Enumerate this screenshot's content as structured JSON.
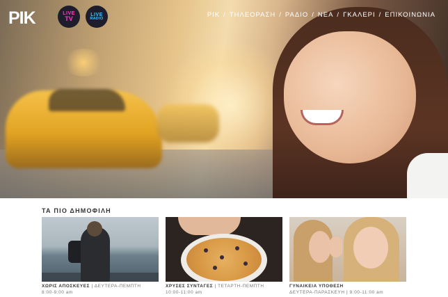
{
  "brand": {
    "logo_text": "ΡΙΚ"
  },
  "live": {
    "tv": {
      "line1": "LIVE",
      "line2": "TV"
    },
    "radio": {
      "line1": "LIVE",
      "line2": "RADIO"
    }
  },
  "nav": {
    "items": [
      {
        "label": "ΡΙΚ"
      },
      {
        "label": "ΤΗΛΕΟΡΑΣΗ"
      },
      {
        "label": "ΡΑΔΙΟ"
      },
      {
        "label": "ΝΕΑ"
      },
      {
        "label": "ΓΚΑΛΕΡΙ"
      },
      {
        "label": "ΕΠΙΚΟΙΝΩΝΙΑ"
      }
    ],
    "separator": "/"
  },
  "popular": {
    "title": "ΤΑ ΠΙΟ ΔΗΜΟΦΙΛΗ",
    "cards": [
      {
        "title": "ΧΩΡΙΣ ΑΠΟΣΚΕΥΕΣ",
        "days": "ΔΕΥΤΕΡΑ-ΠΕΜΠΤΗ",
        "time": "8:00-9:00 am"
      },
      {
        "title": "ΧΡΥΣΕΣ ΣΥΝΤΑΓΕΣ",
        "days": "ΤΕΤΑΡΤΗ-ΠΕΜΠΤΗ",
        "time": "10:00-11:00 am"
      },
      {
        "title": "ΓΥΝΑΙΚΕΙΑ ΥΠΟΘΕΣΗ",
        "days": "ΔΕΥΤΕΡΑ-ΠΑΡΑΣΚΕΥΗ",
        "time": "9:00-11:00 am"
      }
    ]
  },
  "colors": {
    "live_tv_accent": "#ff3cc9",
    "live_radio_accent": "#38c6ff",
    "live_button_bg": "#1d1d2b"
  },
  "icons": {
    "pipe_separator": "|"
  }
}
